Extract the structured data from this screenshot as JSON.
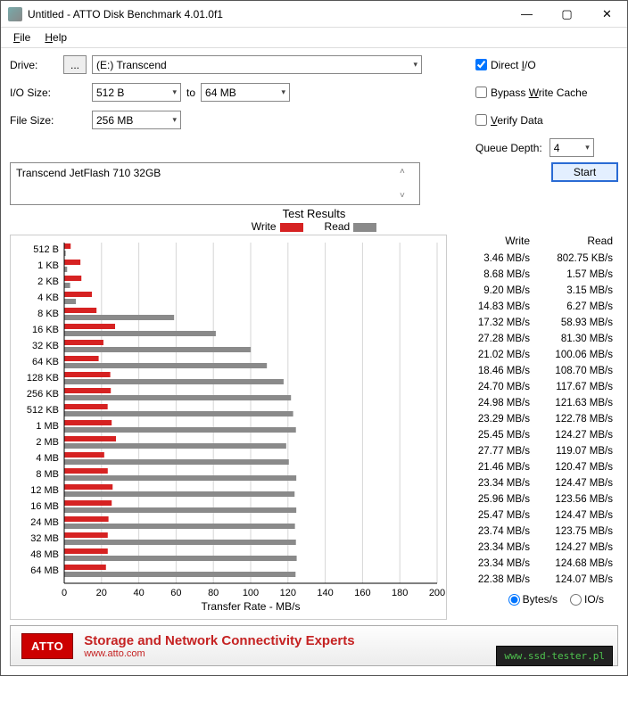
{
  "window": {
    "title": "Untitled - ATTO Disk Benchmark 4.01.0f1"
  },
  "menu": {
    "file": "File",
    "help": "Help"
  },
  "labels": {
    "drive": "Drive:",
    "io_size": "I/O Size:",
    "to": "to",
    "file_size": "File Size:",
    "queue_depth": "Queue Depth:"
  },
  "drive": {
    "browse": "...",
    "selected": "(E:) Transcend"
  },
  "io_size": {
    "from": "512 B",
    "to": "64 MB"
  },
  "file_size": {
    "value": "256 MB"
  },
  "options": {
    "direct_io": "Direct I/O",
    "bypass": "Bypass Write Cache",
    "verify": "Verify Data"
  },
  "queue_depth": {
    "value": "4"
  },
  "description": "Transcend JetFlash 710 32GB",
  "start": "Start",
  "results_title": "Test Results",
  "legend": {
    "write": "Write",
    "read": "Read"
  },
  "table_headers": {
    "write": "Write",
    "read": "Read"
  },
  "axis": {
    "xlabel": "Transfer Rate - MB/s"
  },
  "radios": {
    "bytes": "Bytes/s",
    "ios": "IO/s"
  },
  "banner": {
    "brand": "ATTO",
    "line1": "Storage and Network Connectivity Experts",
    "line2": "www.atto.com"
  },
  "watermark": "www.ssd-tester.pl",
  "chart_data": {
    "type": "bar",
    "orientation": "horizontal",
    "grouped": true,
    "xlabel": "Transfer Rate - MB/s",
    "xlim": [
      0,
      200
    ],
    "xticks": [
      0,
      20,
      40,
      60,
      80,
      100,
      120,
      140,
      160,
      180,
      200
    ],
    "categories": [
      "512 B",
      "1 KB",
      "2 KB",
      "4 KB",
      "8 KB",
      "16 KB",
      "32 KB",
      "64 KB",
      "128 KB",
      "256 KB",
      "512 KB",
      "1 MB",
      "2 MB",
      "4 MB",
      "8 MB",
      "12 MB",
      "16 MB",
      "24 MB",
      "32 MB",
      "48 MB",
      "64 MB"
    ],
    "series": [
      {
        "name": "Write",
        "color": "#d62222",
        "values": [
          3.46,
          8.68,
          9.2,
          14.83,
          17.32,
          27.28,
          21.02,
          18.46,
          24.7,
          24.98,
          23.29,
          25.45,
          27.77,
          21.46,
          23.34,
          25.96,
          25.47,
          23.74,
          23.34,
          23.34,
          22.38
        ]
      },
      {
        "name": "Read",
        "color": "#8a8a8a",
        "values": [
          0.78,
          1.57,
          3.15,
          6.27,
          58.93,
          81.3,
          100.06,
          108.7,
          117.67,
          121.63,
          122.78,
          124.27,
          119.07,
          120.47,
          124.47,
          123.56,
          124.47,
          123.75,
          124.27,
          124.68,
          124.07
        ]
      }
    ],
    "display": [
      {
        "w": "3.46 MB/s",
        "r": "802.75 KB/s"
      },
      {
        "w": "8.68 MB/s",
        "r": "1.57 MB/s"
      },
      {
        "w": "9.20 MB/s",
        "r": "3.15 MB/s"
      },
      {
        "w": "14.83 MB/s",
        "r": "6.27 MB/s"
      },
      {
        "w": "17.32 MB/s",
        "r": "58.93 MB/s"
      },
      {
        "w": "27.28 MB/s",
        "r": "81.30 MB/s"
      },
      {
        "w": "21.02 MB/s",
        "r": "100.06 MB/s"
      },
      {
        "w": "18.46 MB/s",
        "r": "108.70 MB/s"
      },
      {
        "w": "24.70 MB/s",
        "r": "117.67 MB/s"
      },
      {
        "w": "24.98 MB/s",
        "r": "121.63 MB/s"
      },
      {
        "w": "23.29 MB/s",
        "r": "122.78 MB/s"
      },
      {
        "w": "25.45 MB/s",
        "r": "124.27 MB/s"
      },
      {
        "w": "27.77 MB/s",
        "r": "119.07 MB/s"
      },
      {
        "w": "21.46 MB/s",
        "r": "120.47 MB/s"
      },
      {
        "w": "23.34 MB/s",
        "r": "124.47 MB/s"
      },
      {
        "w": "25.96 MB/s",
        "r": "123.56 MB/s"
      },
      {
        "w": "25.47 MB/s",
        "r": "124.47 MB/s"
      },
      {
        "w": "23.74 MB/s",
        "r": "123.75 MB/s"
      },
      {
        "w": "23.34 MB/s",
        "r": "124.27 MB/s"
      },
      {
        "w": "23.34 MB/s",
        "r": "124.68 MB/s"
      },
      {
        "w": "22.38 MB/s",
        "r": "124.07 MB/s"
      }
    ]
  }
}
